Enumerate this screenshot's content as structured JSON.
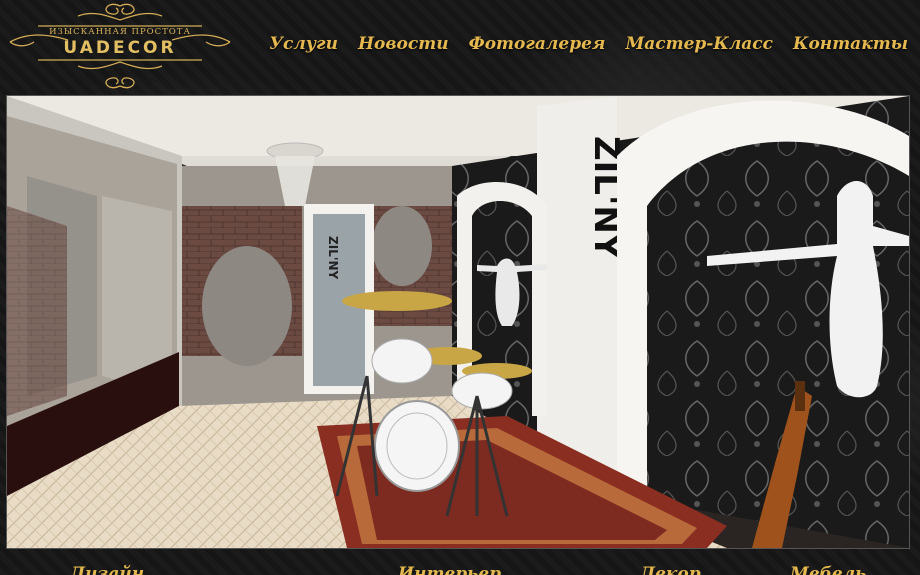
{
  "logo": {
    "tagline": "ИЗЫСКАННАЯ ПРОСТОТА",
    "name": "UADECOR",
    "color": "#e2bf62"
  },
  "nav": {
    "items": [
      {
        "label": "Услуги"
      },
      {
        "label": "Новости"
      },
      {
        "label": "Фотогалерея"
      },
      {
        "label": "Мастер-Класс"
      },
      {
        "label": "Контакты"
      }
    ],
    "color": "#e4b84f"
  },
  "hero": {
    "image": "interior-render-music-room",
    "wall_sign": "ZIL'NY",
    "door_sign": "ZIL'NY"
  },
  "footer": {
    "links": [
      "Дизайн",
      "Интерьер",
      "Декор",
      "Мебель"
    ]
  }
}
